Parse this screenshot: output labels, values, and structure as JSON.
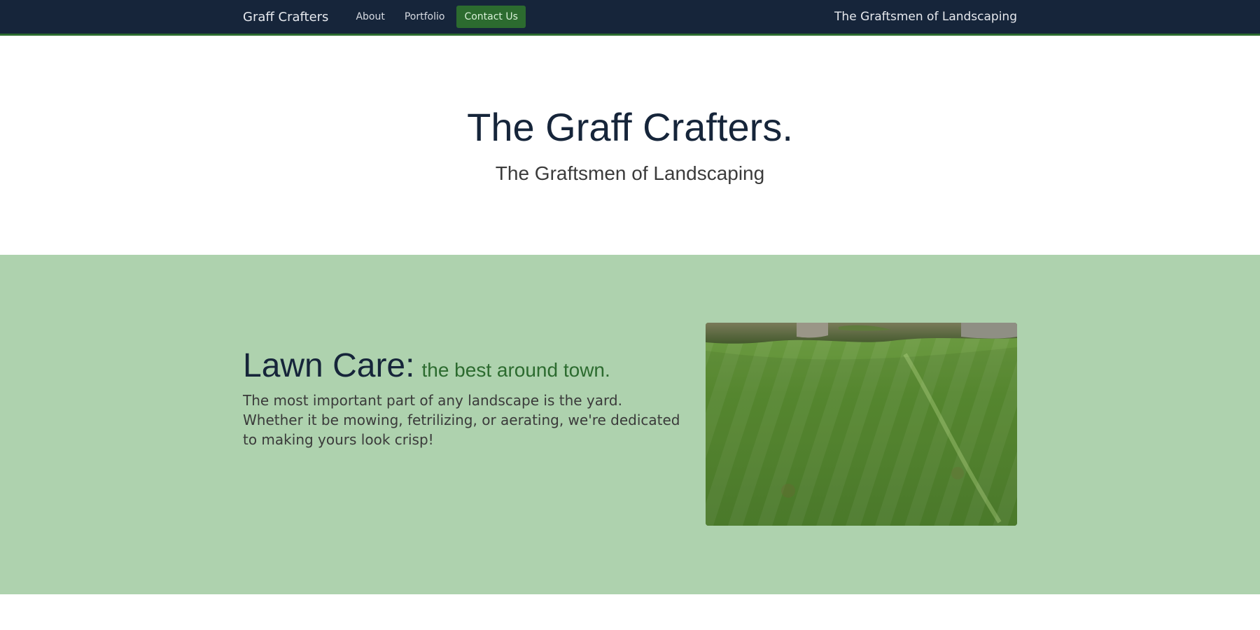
{
  "nav": {
    "brand": "Graff Crafters",
    "links": [
      {
        "label": "About"
      },
      {
        "label": "Portfolio"
      },
      {
        "label": "Contact Us"
      }
    ],
    "tagline": "The Graftsmen of Landscaping"
  },
  "hero": {
    "title": "The Graff Crafters.",
    "subtitle": "The Graftsmen of Landscaping"
  },
  "lawn_care": {
    "title": "Lawn Care:",
    "tagline": "the best around town.",
    "body": "The most important part of any landscape is the yard. Whether it be mowing, fetrilizing, or aerating, we're dedicated to making yours look crisp!"
  },
  "colors": {
    "nav_bg": "#16253a",
    "accent_green": "#2c6b2f",
    "section_bg": "#aed2ae",
    "text_dark": "#16253a"
  }
}
